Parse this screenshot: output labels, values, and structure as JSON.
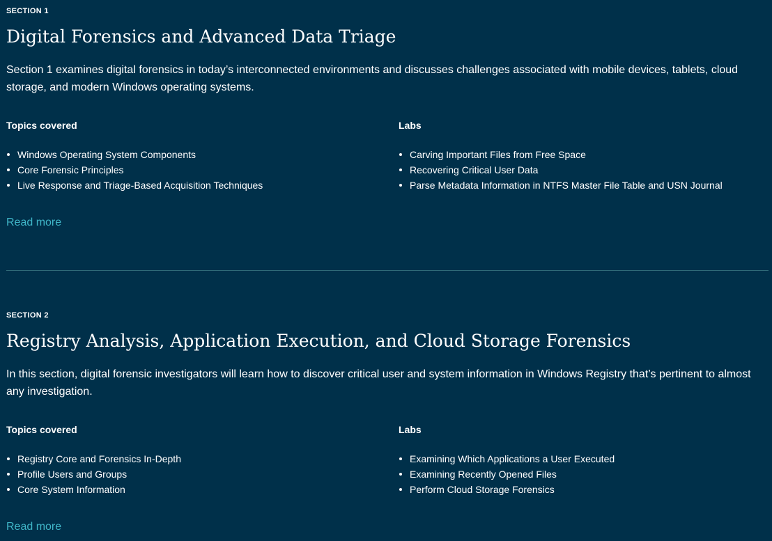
{
  "sections": [
    {
      "eyebrow": "SECTION 1",
      "title": "Digital Forensics and Advanced Data Triage",
      "description": "Section 1 examines digital forensics in today’s interconnected environments and discusses challenges associated with mobile devices, tablets, cloud storage, and modern Windows operating systems.",
      "topics_heading": "Topics covered",
      "topics": [
        "Windows Operating System Components",
        "Core Forensic Principles",
        "Live Response and Triage-Based Acquisition Techniques"
      ],
      "labs_heading": "Labs",
      "labs": [
        "Carving Important Files from Free Space",
        "Recovering Critical User Data",
        "Parse Metadata Information in NTFS Master File Table and USN Journal"
      ],
      "read_more": "Read more"
    },
    {
      "eyebrow": "SECTION 2",
      "title": "Registry Analysis, Application Execution, and Cloud Storage Forensics",
      "description": "In this section, digital forensic investigators will learn how to discover critical user and system information in Windows Registry that’s pertinent to almost any investigation.",
      "topics_heading": "Topics covered",
      "topics": [
        "Registry Core and Forensics In-Depth",
        "Profile Users and Groups",
        "Core System Information"
      ],
      "labs_heading": "Labs",
      "labs": [
        "Examining Which Applications a User Executed",
        "Examining Recently Opened Files",
        "Perform Cloud Storage Forensics"
      ],
      "read_more": "Read more"
    }
  ],
  "colors": {
    "background": "#00304a",
    "text": "#ffffff",
    "link": "#3fb6c8",
    "divider": "#2f6a78"
  }
}
